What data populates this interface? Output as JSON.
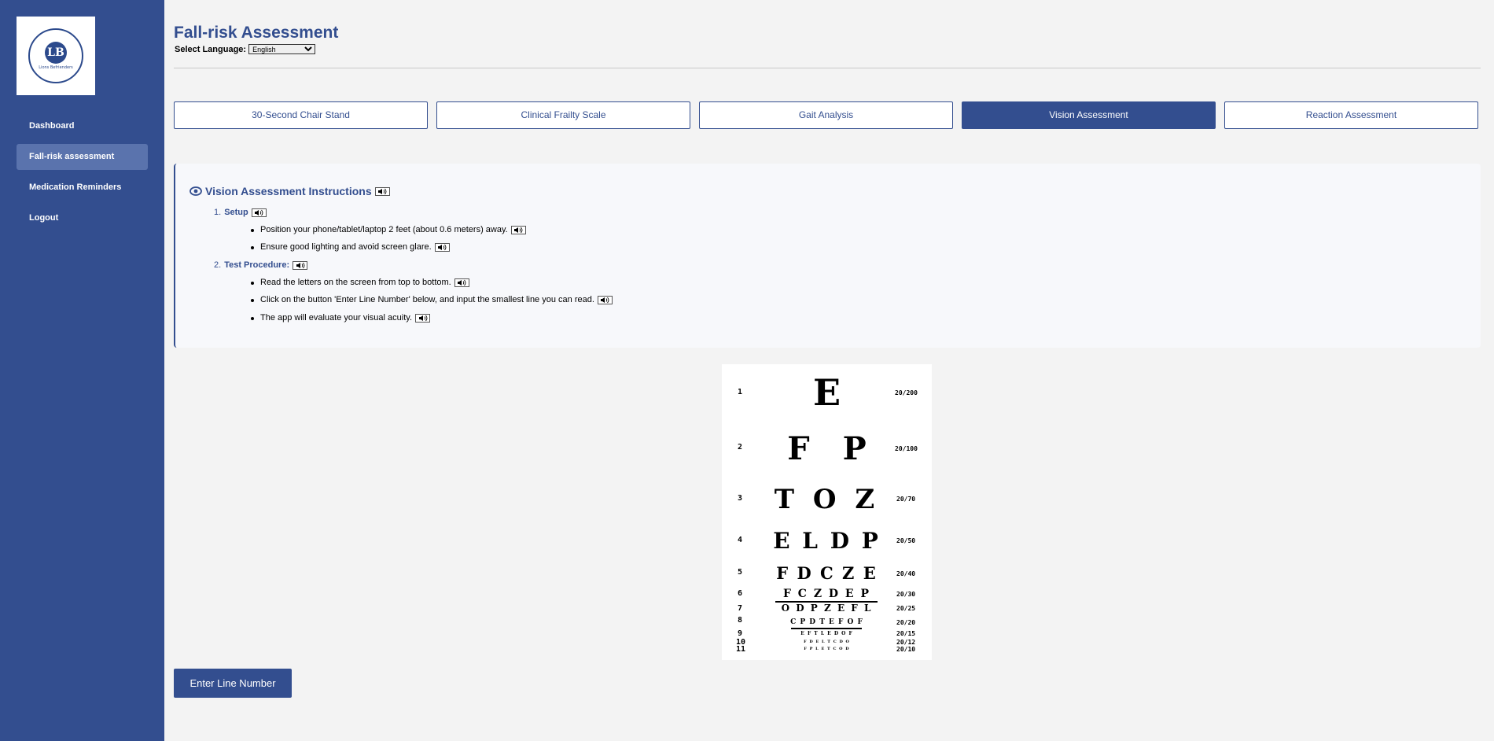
{
  "app": {
    "logo_text": "LIONS BEFRIENDERS SINGAPORE Connecting Seniors, Enriching Lives"
  },
  "sidebar": {
    "items": [
      {
        "label": "Dashboard"
      },
      {
        "label": "Fall-risk assessment"
      },
      {
        "label": "Medication Reminders"
      },
      {
        "label": "Logout"
      }
    ]
  },
  "header": {
    "title": "Fall-risk Assessment",
    "language_label": "Select Language:",
    "language_value": "English"
  },
  "tabs": [
    {
      "label": "30-Second Chair Stand"
    },
    {
      "label": "Clinical Frailty Scale"
    },
    {
      "label": "Gait Analysis"
    },
    {
      "label": "Vision Assessment"
    },
    {
      "label": "Reaction Assessment"
    }
  ],
  "instructions": {
    "title": "Vision Assessment Instructions",
    "steps": [
      {
        "num": "1.",
        "label": "Setup",
        "bullets": [
          "Position your phone/tablet/laptop 2 feet (about 0.6 meters) away.",
          "Ensure good lighting and avoid screen glare."
        ]
      },
      {
        "num": "2.",
        "label": "Test Procedure:",
        "bullets": [
          "Read the letters on the screen from top to bottom.",
          "Click on the button 'Enter Line Number' below, and input the smallest line you can read.",
          "The app will evaluate your visual acuity."
        ]
      }
    ]
  },
  "eye_chart": {
    "rows": [
      {
        "n": "1",
        "letters": "E",
        "acuity": "20/200"
      },
      {
        "n": "2",
        "letters": "F P",
        "acuity": "20/100"
      },
      {
        "n": "3",
        "letters": "T O Z",
        "acuity": "20/70"
      },
      {
        "n": "4",
        "letters": "E L D P",
        "acuity": "20/50"
      },
      {
        "n": "5",
        "letters": "F D C Z E",
        "acuity": "20/40"
      },
      {
        "n": "6",
        "letters": "F C Z D E P",
        "acuity": "20/30"
      },
      {
        "n": "7",
        "letters": "O D P Z E F L",
        "acuity": "20/25"
      },
      {
        "n": "8",
        "letters": "C P D T E F O F",
        "acuity": "20/20"
      },
      {
        "n": "9",
        "letters": "E F T L E D O F",
        "acuity": "20/15"
      },
      {
        "n": "10",
        "letters": "F D E L T C D O",
        "acuity": "20/12"
      },
      {
        "n": "11",
        "letters": "F P L E T C O D",
        "acuity": "20/10"
      }
    ]
  },
  "actions": {
    "enter_line_label": "Enter Line Number"
  },
  "colors": {
    "brand": "#334e8f",
    "sidebar_active": "#5a73ad",
    "background": "#f3f3f3"
  }
}
